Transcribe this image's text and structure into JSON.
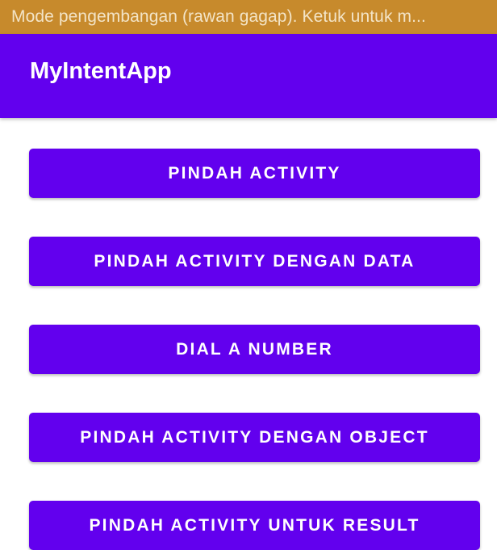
{
  "status_bar": {
    "text": "Mode pengembangan (rawan gagap). Ketuk untuk m...",
    "color": "#c78a2c"
  },
  "app_bar": {
    "title": "MyIntentApp",
    "color": "#6200ee"
  },
  "buttons": [
    {
      "label": "PINDAH ACTIVITY"
    },
    {
      "label": "PINDAH ACTIVITY DENGAN DATA"
    },
    {
      "label": "DIAL A NUMBER"
    },
    {
      "label": "PINDAH ACTIVITY DENGAN OBJECT"
    },
    {
      "label": "PINDAH ACTIVITY UNTUK RESULT"
    }
  ]
}
